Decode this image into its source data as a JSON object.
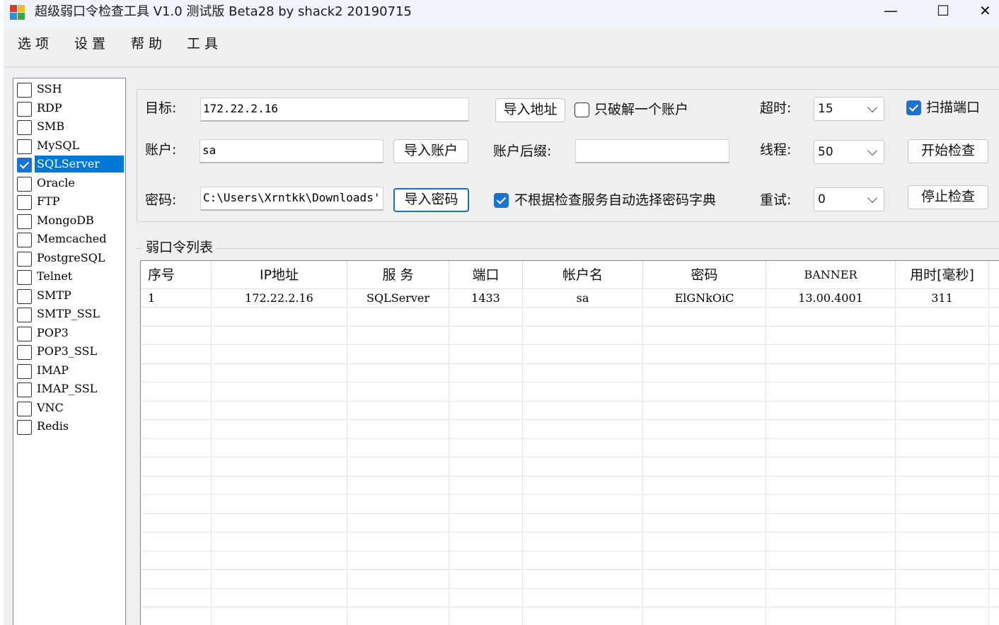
{
  "window": {
    "title": "超级弱口令检查工具 V1.0 测试版 Beta28 by shack2 20190715",
    "minimize_glyph": "—",
    "maximize_glyph": "☐",
    "close_glyph": "✕",
    "icon": "app-icon",
    "icon_colors": [
      "#d93b2b",
      "#f2b830",
      "#2f8fe0",
      "#3aa84a"
    ]
  },
  "menu": [
    "选项",
    "设置",
    "帮助",
    "工具"
  ],
  "services": [
    {
      "label": "SSH",
      "checked": false
    },
    {
      "label": "RDP",
      "checked": false
    },
    {
      "label": "SMB",
      "checked": false
    },
    {
      "label": "MySQL",
      "checked": false
    },
    {
      "label": "SQLServer",
      "checked": true,
      "selected": true
    },
    {
      "label": "Oracle",
      "checked": false
    },
    {
      "label": "FTP",
      "checked": false
    },
    {
      "label": "MongoDB",
      "checked": false
    },
    {
      "label": "Memcached",
      "checked": false
    },
    {
      "label": "PostgreSQL",
      "checked": false
    },
    {
      "label": "Telnet",
      "checked": false
    },
    {
      "label": "SMTP",
      "checked": false
    },
    {
      "label": "SMTP_SSL",
      "checked": false
    },
    {
      "label": "POP3",
      "checked": false
    },
    {
      "label": "POP3_SSL",
      "checked": false
    },
    {
      "label": "IMAP",
      "checked": false
    },
    {
      "label": "IMAP_SSL",
      "checked": false
    },
    {
      "label": "VNC",
      "checked": false
    },
    {
      "label": "Redis",
      "checked": false
    }
  ],
  "config": {
    "target_label": "目标:",
    "target_value": "172.22.2.16",
    "import_address_button": "导入地址",
    "only_one_account_label": "只破解一个账户",
    "only_one_account_checked": false,
    "timeout_label": "超时:",
    "timeout_value": "15",
    "scan_port_label": "扫描端口",
    "scan_port_checked": true,
    "account_label": "账户:",
    "account_value": "sa",
    "import_account_button": "导入账户",
    "account_suffix_label": "账户后缀:",
    "account_suffix_value": "",
    "threads_label": "线程:",
    "threads_value": "50",
    "start_button": "开始检查",
    "password_label": "密码:",
    "password_value": "C:\\Users\\Xrntkk\\Downloads'",
    "import_password_button": "导入密码",
    "no_auto_dict_label": "不根据检查服务自动选择密码字典",
    "no_auto_dict_checked": true,
    "retry_label": "重试:",
    "retry_value": "0",
    "stop_button": "停止检查"
  },
  "results": {
    "title": "弱口令列表",
    "columns": [
      "序号",
      "IP地址",
      "服 务",
      "端口",
      "帐户名",
      "密码",
      "BANNER",
      "用时[毫秒]"
    ],
    "rows": [
      [
        "1",
        "172.22.2.16",
        "SQLServer",
        "1433",
        "sa",
        "ElGNkOiC",
        "13.00.4001",
        "311"
      ]
    ]
  },
  "colors": {
    "selection": "#0078d7",
    "checkbox_on": "#1a73d0",
    "focus_border": "#1a6fc4"
  }
}
